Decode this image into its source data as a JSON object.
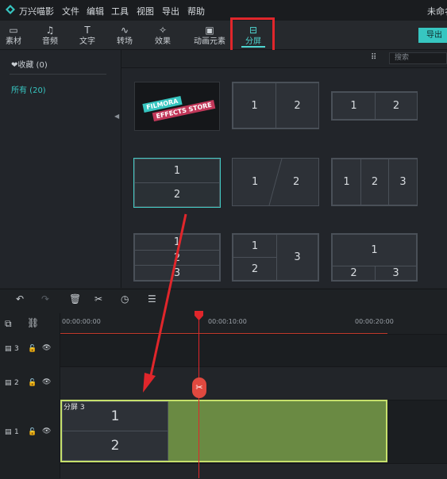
{
  "menubar": {
    "app_name": "万兴喵影",
    "items": [
      "文件",
      "编辑",
      "工具",
      "视图",
      "导出",
      "帮助"
    ],
    "project_title": "未命名"
  },
  "toolbar": {
    "items": [
      {
        "label": "素材",
        "icon": "folder-icon"
      },
      {
        "label": "音频",
        "icon": "music-note-icon"
      },
      {
        "label": "文字",
        "icon": "text-icon"
      },
      {
        "label": "转场",
        "icon": "transition-icon"
      },
      {
        "label": "效果",
        "icon": "effects-icon"
      },
      {
        "label": "动画元素",
        "icon": "elements-icon"
      },
      {
        "label": "分屏",
        "icon": "split-screen-icon"
      }
    ],
    "active": "分屏",
    "export_label": "导出"
  },
  "left_panel": {
    "favorites": "❤收藏 (0)",
    "all": "所有 (20)"
  },
  "gallery": {
    "search_placeholder": "搜索",
    "promo": {
      "line1": "FILMORA",
      "line2": "EFFECTS STORE"
    },
    "templates": [
      {
        "cells": [
          "1",
          "2"
        ]
      },
      {
        "cells": [
          "1",
          "2"
        ]
      },
      {
        "cells": [
          "1",
          "2"
        ],
        "selected": true
      },
      {
        "cells": [
          "1",
          "2"
        ]
      },
      {
        "cells": [
          "1",
          "2",
          "3"
        ]
      },
      {
        "cells": [
          "1",
          "2",
          "3"
        ]
      },
      {
        "cells": [
          "1",
          "2",
          "3"
        ]
      },
      {
        "cells": [
          "1",
          "2",
          "3"
        ]
      }
    ]
  },
  "timeline": {
    "ruler": [
      "00:00:00:00",
      "00:00:10:00",
      "00:00:20:00"
    ],
    "tracks": [
      {
        "num": "3"
      },
      {
        "num": "2"
      },
      {
        "num": "1"
      }
    ],
    "clip": {
      "label": "分屏 3",
      "cell1": "1",
      "cell2": "2"
    }
  },
  "colors": {
    "accent": "#37c6c1",
    "highlight": "#e0262b",
    "clip_fill": "#6a8a43",
    "clip_border": "#c6e06c"
  }
}
